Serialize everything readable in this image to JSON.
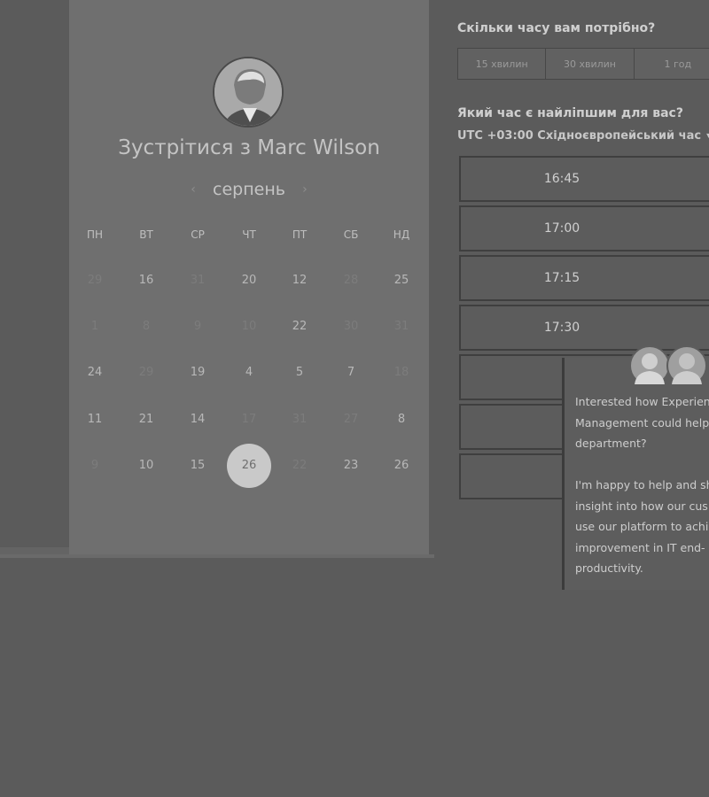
{
  "booking": {
    "host_title": "Зустрітися з Marc Wilson",
    "month": "серпень",
    "prev_icon": "chevron-left-icon",
    "next_icon": "chevron-right-icon",
    "weekdays": [
      "ПН",
      "ВТ",
      "СР",
      "ЧТ",
      "ПТ",
      "СБ",
      "НД"
    ],
    "weeks": [
      [
        "29",
        "16",
        "31",
        "20",
        "12",
        "28",
        "25"
      ],
      [
        "1",
        "8",
        "9",
        "10",
        "22",
        "30",
        "31"
      ],
      [
        "24",
        "29",
        "19",
        "4",
        "5",
        "7",
        "18"
      ],
      [
        "11",
        "21",
        "14",
        "17",
        "31",
        "27",
        "8"
      ],
      [
        "9",
        "10",
        "15",
        "26",
        "22",
        "23",
        "26"
      ]
    ],
    "selected_day": "26"
  },
  "duration": {
    "question": "Скільки часу вам потрібно?",
    "options": [
      "15 хвилин",
      "30 хвилин",
      "1 год"
    ]
  },
  "times": {
    "question": "Який час є найліпшим для вас?",
    "timezone": "UTC +03:00 Східноєвропейський час",
    "timezone_icon": "chevron-down-icon",
    "slots": [
      "16:45",
      "17:00",
      "17:15",
      "17:30",
      "",
      "",
      ""
    ]
  },
  "chat": {
    "message_1": "Interested how Experien\nManagement could help\ndepartment?",
    "message_2": "I'm happy to help and sh\ninsight into how our cus\nuse our platform to achi\nimprovement in IT end-\nproductivity."
  }
}
